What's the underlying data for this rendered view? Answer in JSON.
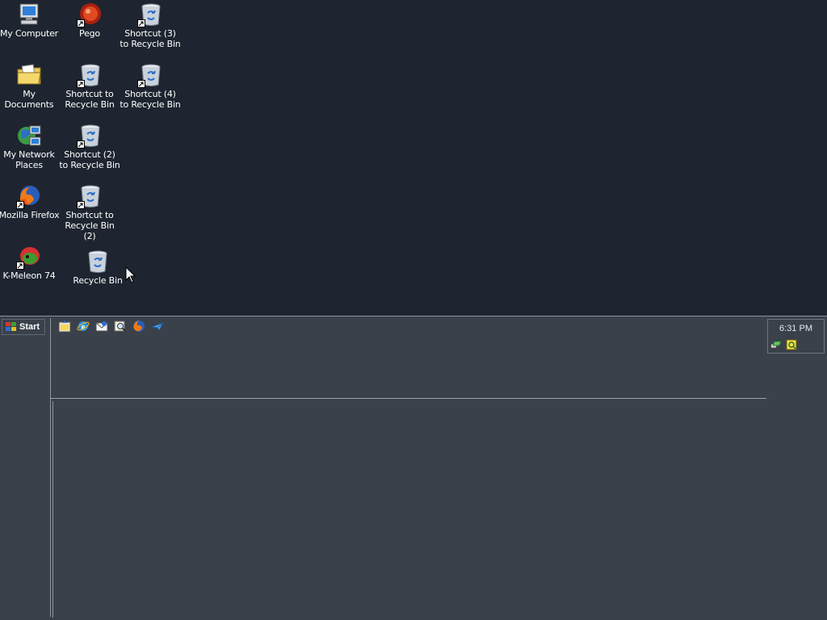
{
  "desktop": {
    "icons": [
      {
        "label": "My Computer",
        "icon": "computer-icon"
      },
      {
        "label": "My Documents",
        "icon": "folder-icon"
      },
      {
        "label": "My Network Places",
        "icon": "network-icon"
      },
      {
        "label": "Mozilla Firefox",
        "icon": "firefox-icon"
      },
      {
        "label": "K-Meleon 74",
        "icon": "kmeleon-icon"
      },
      {
        "label": "Pego",
        "icon": "pego-icon"
      },
      {
        "label": "Shortcut to Recycle Bin",
        "icon": "recycle-bin-icon"
      },
      {
        "label": "Shortcut (2) to Recycle Bin",
        "icon": "recycle-bin-icon"
      },
      {
        "label": "Shortcut to Recycle Bin (2)",
        "icon": "recycle-bin-icon"
      },
      {
        "label": "Recycle Bin",
        "icon": "recycle-bin-icon"
      },
      {
        "label": "Shortcut (3) to Recycle Bin",
        "icon": "recycle-bin-icon"
      },
      {
        "label": "Shortcut (4) to Recycle Bin",
        "icon": "recycle-bin-icon"
      }
    ]
  },
  "taskbar": {
    "start_label": "Start",
    "quick_launch": [
      "show-desktop-icon",
      "internet-explorer-icon",
      "outlook-express-icon",
      "search-icon",
      "firefox-icon",
      "send-icon"
    ],
    "tray": {
      "time": "6:31 PM",
      "icons": [
        "network-connection-icon",
        "security-alert-icon"
      ]
    }
  },
  "colors": {
    "desktop_bg": "#1e2530",
    "taskbar_bg": "#3a414b"
  }
}
